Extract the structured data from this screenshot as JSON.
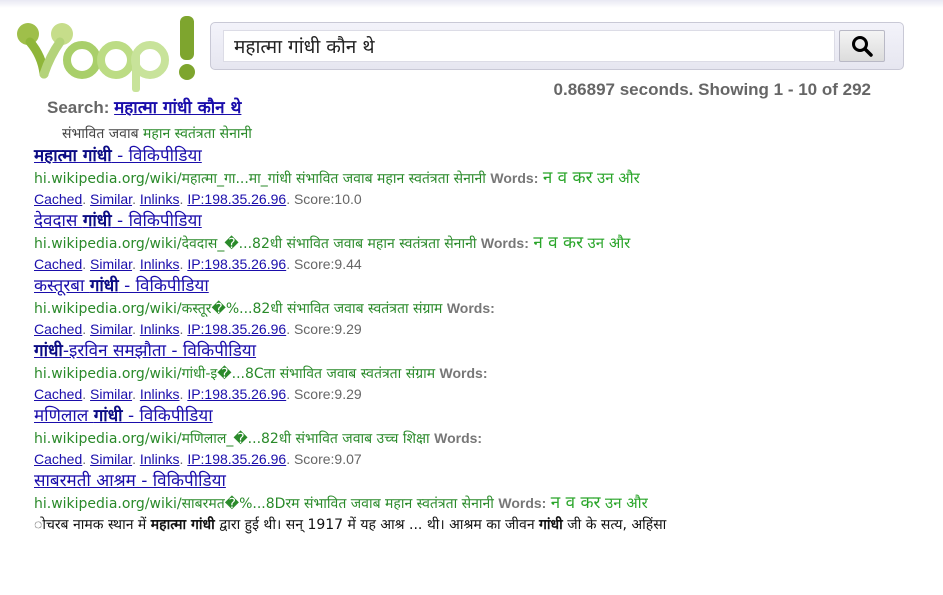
{
  "query": "महात्मा गांधी कौन थे",
  "stats": "0.86897 seconds. Showing 1 - 10 of 292",
  "search_label": "Search:",
  "possible_prefix": "संभावित जवाब",
  "possible_answer": "महान स्वतंत्रता सेनानी",
  "link_labels": {
    "cached": "Cached",
    "similar": "Similar",
    "inlinks": "Inlinks"
  },
  "colors": {
    "link": "#1a0dab",
    "url_green": "#2a8a2a",
    "word_green": "#2aa52a",
    "gray": "#666666"
  },
  "icons": {
    "search": "magnifier-icon",
    "logo": "yoop-logo"
  },
  "results": [
    {
      "title_bold": "महात्मा गांधी",
      "title_rest": " - विकिपीडिया",
      "url": "hi.wikipedia.org/wiki/महात्मा_गा...मा_गांधी",
      "possible": "संभावित जवाब महान स्वतंत्रता सेनानी",
      "words_label": "Words:",
      "words_big": "न व कर",
      "words_small": "उन और",
      "ip": "IP:198.35.26.96",
      "score": "Score:10.0"
    },
    {
      "title_plain": "देवदास ",
      "title_bold": "गांधी",
      "title_rest": " - विकिपीडिया",
      "url": "hi.wikipedia.org/wiki/देवदास_�...82धी",
      "possible": "संभावित जवाब महान स्वतंत्रता सेनानी",
      "words_label": "Words:",
      "words_big": "न व कर",
      "words_small": "उन और",
      "ip": "IP:198.35.26.96",
      "score": "Score:9.44"
    },
    {
      "title_plain": "कस्तूरबा ",
      "title_bold": "गांधी",
      "title_rest": " - विकिपीडिया",
      "url": "hi.wikipedia.org/wiki/कस्तूर�%...82धी",
      "possible": "संभावित जवाब स्वतंत्रता संग्राम",
      "words_label": "Words:",
      "ip": "IP:198.35.26.96",
      "score": "Score:9.29"
    },
    {
      "title_bold": "गांधी",
      "title_rest": "-इरविन समझौता - विकिपीडिया",
      "url": "hi.wikipedia.org/wiki/गांधी-इ�...8Cता",
      "possible": "संभावित जवाब स्वतंत्रता संग्राम",
      "words_label": "Words:",
      "ip": "IP:198.35.26.96",
      "score": "Score:9.29"
    },
    {
      "title_plain": "मणिलाल ",
      "title_bold": "गांधी",
      "title_rest": " - विकिपीडिया",
      "url": "hi.wikipedia.org/wiki/मणिलाल_�...82धी",
      "possible": "संभावित जवाब उच्च शिक्षा",
      "words_label": "Words:",
      "ip": "IP:198.35.26.96",
      "score": "Score:9.07"
    },
    {
      "title_plain": "साबरमती आश्रम - विकिपीडिया",
      "url": "hi.wikipedia.org/wiki/साबरमत�%...8Dरम",
      "possible": "संभावित जवाब महान स्वतंत्रता सेनानी",
      "words_label": "Words:",
      "words_big": "न व कर",
      "words_small": "उन और",
      "snippet_pre": "ोचरब नामक स्थान में ",
      "snippet_b1": "महात्मा गांधी",
      "snippet_mid": " द्वारा हुई थी। सन् 1917 में यह आश्र ... थी। आश्रम का जीवन ",
      "snippet_b2": "गांधी",
      "snippet_post": " जी के सत्य, अहिंसा"
    }
  ]
}
